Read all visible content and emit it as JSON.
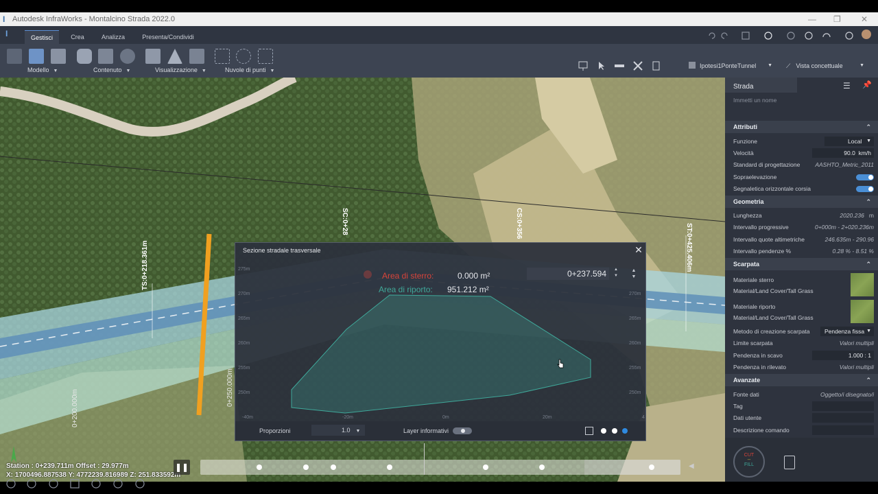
{
  "window": {
    "title": "Autodesk InfraWorks - Montalcino Strada 2022.0"
  },
  "ribbon": {
    "tabs": [
      {
        "label": "Gestisci",
        "active": true
      },
      {
        "label": "Crea",
        "active": false
      },
      {
        "label": "Analizza",
        "active": false
      },
      {
        "label": "Presenta/Condividi",
        "active": false
      }
    ],
    "groups": {
      "modello": "Modello",
      "contenuto": "Contenuto",
      "visualizzazione": "Visualizzazione",
      "nuvole": "Nuvole di punti"
    },
    "proposal": "Ipotesi1PonteTunnel",
    "view_style": "Vista concettuale"
  },
  "viewport": {
    "station_labels": [
      "TS:0+218.361m",
      "SC:0+28",
      "CS:0+356",
      "ST:0+425.406m",
      "0+200.000m",
      "0+250.000m"
    ]
  },
  "dialog": {
    "title": "Sezione stradale trasversale",
    "cut_label": "Area di sterro:",
    "cut_value": "0.000 m²",
    "fill_label": "Area di riporto:",
    "fill_value": "951.212 m²",
    "station_value": "0+237.594",
    "y_ticks": [
      "275m",
      "270m",
      "265m",
      "260m",
      "255m",
      "250m"
    ],
    "y_ticks_right": [
      "270m",
      "265m",
      "260m",
      "255m",
      "250m"
    ],
    "x_ticks": [
      "-40m",
      "-20m",
      "0m",
      "20m",
      "4"
    ],
    "proporzioni_label": "Proporzioni",
    "proporzioni_value": "1.0",
    "layer_label": "Layer informativi",
    "colors": {
      "cut": "#d9443a",
      "fill": "#3fa89a"
    }
  },
  "panel": {
    "title": "Strada",
    "name_placeholder": "Immetti un nome",
    "sections": {
      "attributi": "Attributi",
      "geometria": "Geometria",
      "scarpata": "Scarpata",
      "avanzate": "Avanzate"
    },
    "attributi": {
      "funzione_label": "Funzione",
      "funzione_value": "Local",
      "velocita_label": "Velocità",
      "velocita_value": "90.0",
      "velocita_unit": "km/h",
      "standard_label": "Standard di progettazione",
      "standard_value": "AASHTO_Metric_2011",
      "soprael_label": "Sopraelevazione",
      "segnaletica_label": "Segnaletica orizzontale corsia"
    },
    "geometria": {
      "lunghezza_label": "Lunghezza",
      "lunghezza_value": "2020.236",
      "lunghezza_unit": "m",
      "progressive_label": "Intervallo progressive",
      "progressive_value": "0+000m - 2+020.236m",
      "quote_label": "Intervallo quote altimetriche",
      "quote_value": "246.635m - 290.96",
      "pendenze_label": "Intervallo pendenze %",
      "pendenze_value": "0.28 % - 8.51 %"
    },
    "scarpata": {
      "sterro_label": "Materiale sterro",
      "sterro_value": "Material/Land Cover/Tall Grass",
      "riporto_label": "Materiale riporto",
      "riporto_value": "Material/Land Cover/Tall Grass",
      "metodo_label": "Metodo di creazione scarpata",
      "metodo_value": "Pendenza fissa",
      "limite_label": "Limite scarpata",
      "limite_value": "Valori multipli",
      "scavo_label": "Pendenza in scavo",
      "scavo_value": "1.000 : 1",
      "rilevato_label": "Pendenza in rilevato",
      "rilevato_value": "Valori multipli"
    },
    "avanzate": {
      "fonte_label": "Fonte dati",
      "fonte_value": "Oggetto/i disegnato/i",
      "tag_label": "Tag",
      "utente_label": "Dati utente",
      "comando_label": "Descrizione comando"
    },
    "cutfill": {
      "cut": "CUT",
      "fill": "FILL"
    }
  },
  "status": {
    "line1": "Station : 0+239.711m Offset : 29.977m",
    "line2": "X: 1700496.887538 Y: 4772239.816989 Z: 251.833592m"
  }
}
